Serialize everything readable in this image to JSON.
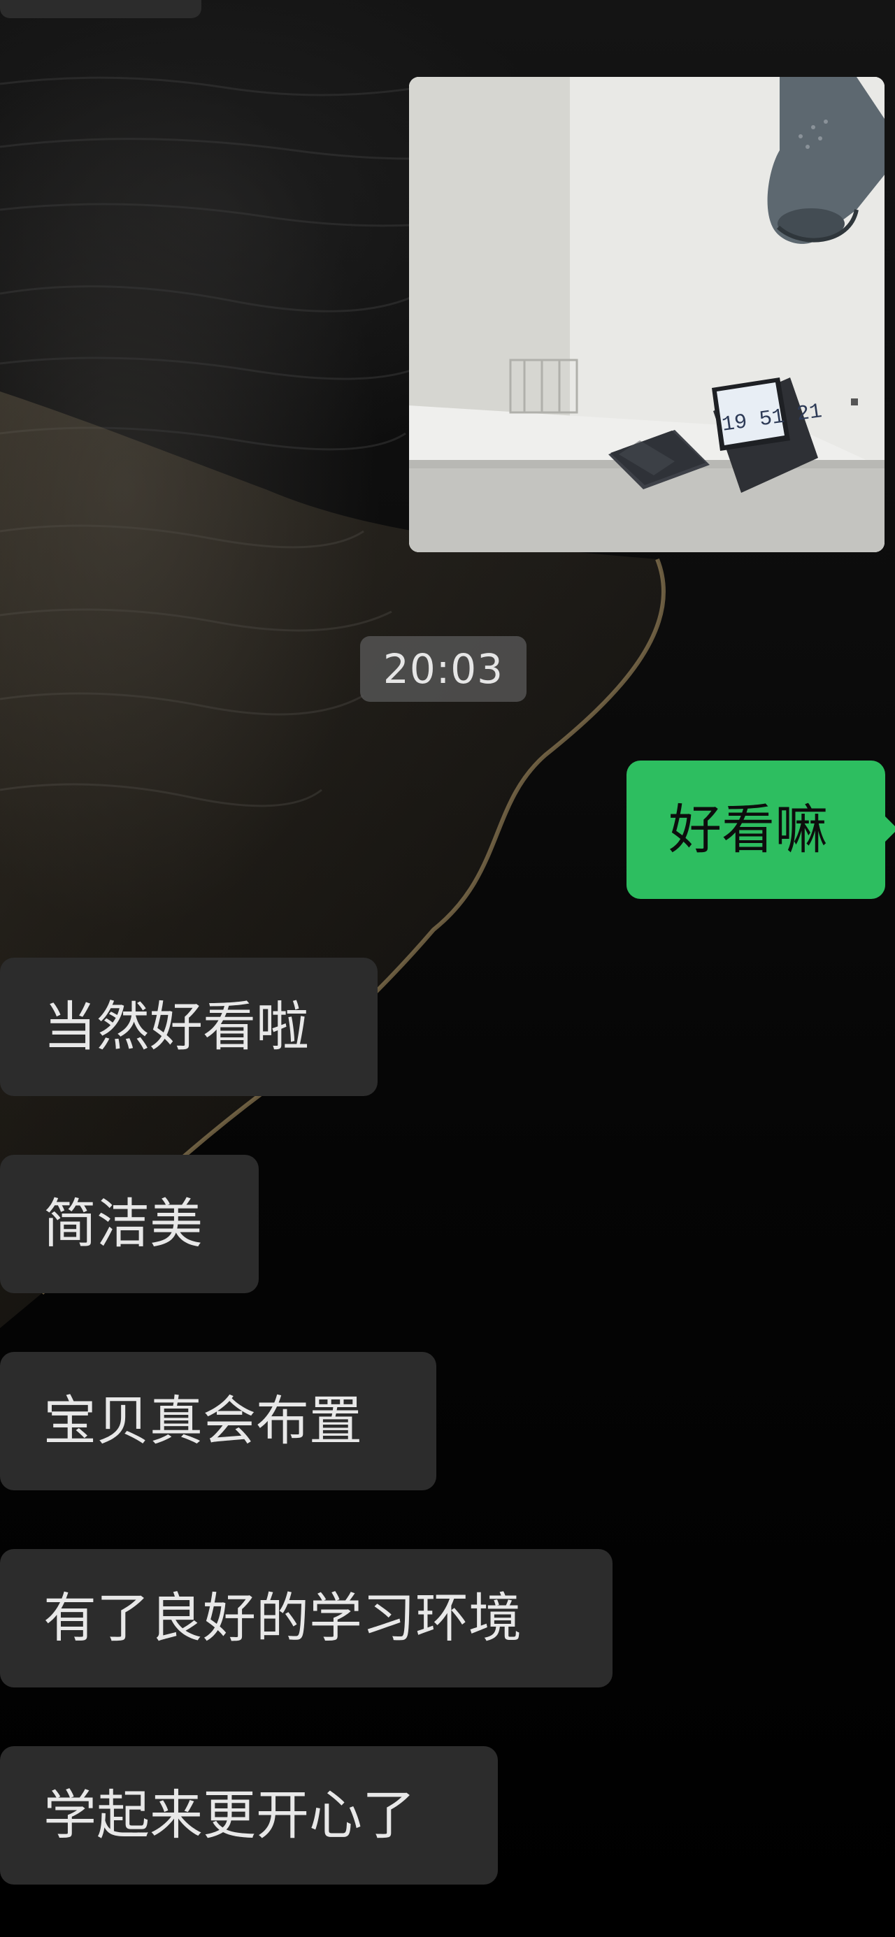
{
  "chat": {
    "timestamp": "20:03",
    "photo": {
      "kind": "image",
      "subject": "desk-with-lamp-ipad-keyboard",
      "clock_digits": "19 51 21"
    },
    "messages": [
      {
        "side": "outgoing",
        "text": "好看嘛"
      },
      {
        "side": "incoming",
        "text": "当然好看啦"
      },
      {
        "side": "incoming",
        "text": "简洁美"
      },
      {
        "side": "incoming",
        "text": "宝贝真会布置"
      },
      {
        "side": "incoming",
        "text": "有了良好的学习环境"
      },
      {
        "side": "incoming",
        "text": "学起来更开心了"
      }
    ]
  },
  "colors": {
    "outgoing_bubble": "#2dbe60",
    "incoming_bubble": "#2c2c2c",
    "background": "#000000"
  }
}
